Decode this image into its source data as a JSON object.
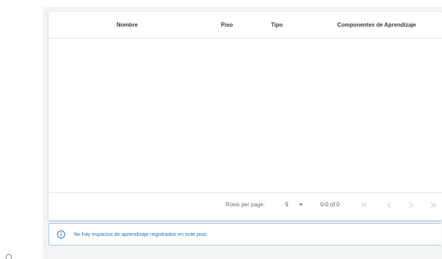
{
  "table": {
    "columns": [
      "Nombre",
      "Piso",
      "Tipo",
      "Componentes de Aprendizaje"
    ],
    "rows": []
  },
  "pagination": {
    "rows_per_page_label": "Rows per page:",
    "rows_per_page_value": "5",
    "range_text": "0-0 of 0"
  },
  "alert": {
    "icon": "info-circle-icon",
    "message": "No hay espacios de aprendizaje registrados en este piso.",
    "color": "#1f6fb2"
  },
  "colors": {
    "background": "#f4f4f6",
    "alert_border": "#9ecbf2",
    "alert_text": "#1f6fb2"
  }
}
